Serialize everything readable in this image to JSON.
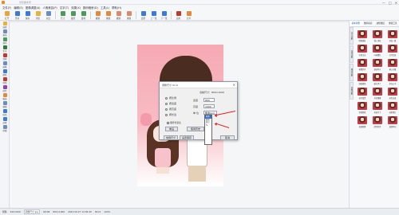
{
  "window": {
    "title": "光影魔术手",
    "controls": [
      "—",
      "□",
      "✕"
    ]
  },
  "menu": [
    "文件(F)",
    "编辑(E)",
    "图像调整(A)",
    "人像美容(P)",
    "文字(T)",
    "效果(X)",
    "数码暗房(D)",
    "工具(L)",
    "帮助(H)"
  ],
  "toolbar": [
    {
      "label": "打开",
      "color": "#e8a33a"
    },
    {
      "label": "另存",
      "color": "#3a7bd5"
    },
    {
      "label": "保存",
      "color": "#3a7bd5"
    },
    {
      "label": "浏览",
      "color": "#e6b23c"
    },
    {
      "label": "对比",
      "color": "#6c8ebf"
    },
    {
      "label": "尺寸",
      "color": "#4a9a5a"
    },
    {
      "label": "裁剪",
      "color": "#4a9a5a"
    },
    {
      "label": "旋转",
      "color": "#4a9a5a"
    },
    {
      "label": "撤销",
      "color": "#e08a3a"
    },
    {
      "label": "重做",
      "color": "#e08a3a"
    },
    {
      "label": "撤销",
      "color": "#d88a6a"
    },
    {
      "label": "重做",
      "color": "#d88a6a"
    },
    {
      "label": "还原",
      "color": "#3a7bd5"
    },
    {
      "label": "上一张",
      "color": "#3a7bd5"
    },
    {
      "label": "下一张",
      "color": "#3a7bd5"
    },
    {
      "label": "实用",
      "color": "#c0392b"
    },
    {
      "label": "分享",
      "color": "#e08a3a"
    }
  ],
  "lefttools": [
    {
      "label": "选择",
      "color": "#e6b23c"
    },
    {
      "label": "移动",
      "color": "#6c8ebf"
    },
    {
      "label": "裁剪",
      "color": "#4a9a5a"
    },
    {
      "label": "文字",
      "color": "#2e7d32"
    },
    {
      "label": "涂鸦",
      "color": "#c0392b"
    },
    {
      "label": "画笔",
      "color": "#6c8ebf"
    },
    {
      "label": "擦除",
      "color": "#3a7bd5"
    },
    {
      "label": "仿制",
      "color": "#c0392b"
    },
    {
      "label": "修复",
      "color": "#8e44ad"
    },
    {
      "label": "圈选",
      "color": "#e08a3a"
    },
    {
      "label": "模糊",
      "color": "#6c8ebf"
    },
    {
      "label": "取色",
      "color": "#3a7bd5"
    },
    {
      "label": "边框",
      "color": "#3a7bd5"
    },
    {
      "label": "拼图",
      "color": "#6c8ebf"
    }
  ],
  "dialog": {
    "title": "调整尺寸 V1.0",
    "close": "✕",
    "size_label": "当前尺寸：",
    "size_value": "800×1000",
    "options": [
      "按比例",
      "按宽度",
      "按高度",
      "按长宽"
    ],
    "width_label": "宽度",
    "width_value": "800",
    "height_label": "高度",
    "height_value": "1000",
    "unit_label": "单 位",
    "unit_value": "像素(px)",
    "keep_ratio": "保持长宽比",
    "list": [
      "像素(px)",
      "厘米",
      "英寸",
      "%",
      "",
      "",
      "",
      "",
      "",
      "",
      ""
    ],
    "reset_button": "重设",
    "history_button": "使用历史",
    "preset_button": "常用尺寸",
    "save_button": "设置保存",
    "ok_button": "确定",
    "cancel_button": "取消"
  },
  "rightpanel": {
    "tabs": [
      "基本调整",
      "数码暗房",
      "边框图层",
      "便捷工具"
    ],
    "side_tabs": [
      "文字边框",
      "花样边框",
      "撕边边框",
      "多图边框"
    ],
    "thumbs": [
      "暗香疏影",
      "锦上添花",
      "沧海一粟",
      "冰清玉洁",
      "叶碎缨红",
      "白月红装",
      "粉黛罗丹",
      "落花时节",
      "春江水暖",
      "绿意盎然",
      "秋水伊人",
      "美在心中",
      "花开富贵",
      "芳草萋萋",
      "宛若天成",
      "你我他她",
      "花前月下",
      "姹紫嫣红",
      "金碧辉煌",
      "简约时尚",
      "温情时刻"
    ]
  },
  "status": [
    "帮助",
    "420×600",
    "调整尺寸.jpg",
    "96 KB",
    "800×1000",
    "2023-09-27 14:36:40",
    "ISO:0",
    "100%"
  ]
}
